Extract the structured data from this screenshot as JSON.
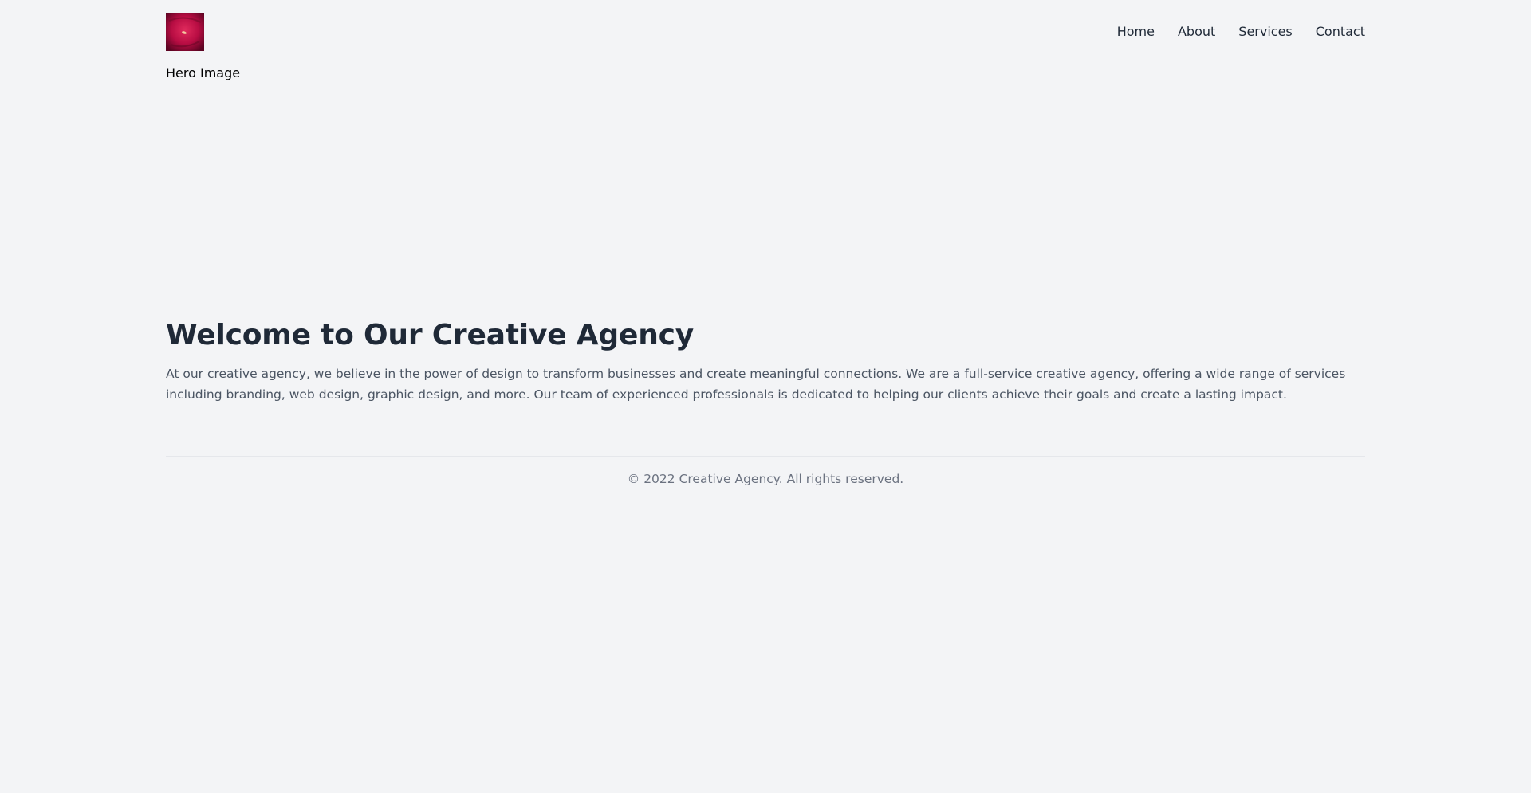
{
  "header": {
    "logo": {
      "icon": "rose-thumbnail",
      "colors": [
        "#a3093a",
        "#d8184e",
        "#5c0422"
      ]
    },
    "nav": [
      {
        "label": "Home"
      },
      {
        "label": "About"
      },
      {
        "label": "Services"
      },
      {
        "label": "Contact"
      }
    ]
  },
  "hero": {
    "image_alt": "Hero Image"
  },
  "main": {
    "title": "Welcome to Our Creative Agency",
    "intro": "At our creative agency, we believe in the power of design to transform businesses and create meaningful connections. We are a full-service creative agency, offering a wide range of services including branding, web design, graphic design, and more. Our team of experienced professionals is dedicated to helping our clients achieve their goals and create a lasting impact."
  },
  "footer": {
    "copyright": "© 2022 Creative Agency. All rights reserved."
  },
  "colors": {
    "background": "#f3f4f6",
    "heading": "#1f2937",
    "body_text": "#4b5563",
    "muted": "#6b7280",
    "divider": "#e5e7eb"
  }
}
